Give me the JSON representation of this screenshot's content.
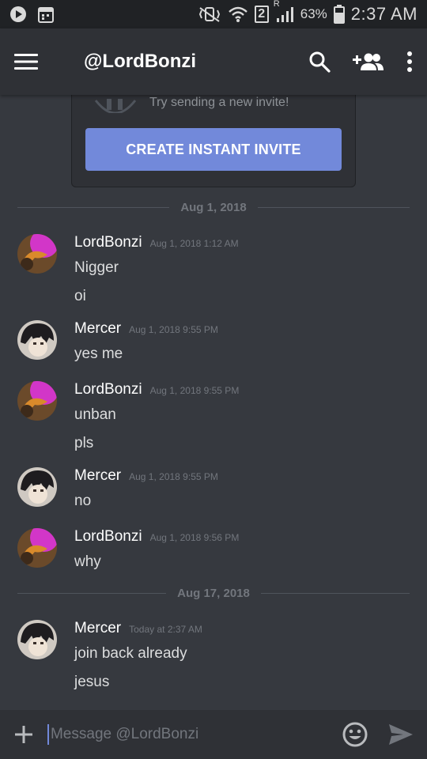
{
  "status_bar": {
    "battery": "63%",
    "time": "2:37 AM",
    "sim_slot": "2",
    "roaming": "R",
    "left_icons": [
      "play-icon",
      "calendar-icon"
    ],
    "right_icons": [
      "mute-vibrate-icon",
      "wifi-icon",
      "sim-icon",
      "signal-icon",
      "battery-icon"
    ]
  },
  "app_bar": {
    "title": "@LordBonzi",
    "icons": [
      "menu-icon",
      "search-icon",
      "add-friend-icon",
      "more-icon"
    ]
  },
  "invite_card": {
    "hint": "Try sending a new invite!",
    "button_label": "CREATE INSTANT INVITE"
  },
  "dividers": [
    "Aug 1, 2018",
    "Aug 17, 2018"
  ],
  "messages": [
    {
      "author": "LordBonzi",
      "timestamp": "Aug 1, 2018 1:12 AM",
      "lines": [
        "Nigger",
        "oi"
      ]
    },
    {
      "author": "Mercer",
      "timestamp": "Aug 1, 2018 9:55 PM",
      "lines": [
        "yes me"
      ]
    },
    {
      "author": "LordBonzi",
      "timestamp": "Aug 1, 2018 9:55 PM",
      "lines": [
        "unban",
        "pls"
      ]
    },
    {
      "author": "Mercer",
      "timestamp": "Aug 1, 2018 9:55 PM",
      "lines": [
        "no"
      ]
    },
    {
      "author": "LordBonzi",
      "timestamp": "Aug 1, 2018 9:56 PM",
      "lines": [
        "why"
      ]
    },
    {
      "author": "Mercer",
      "timestamp": "Today at 2:37 AM",
      "lines": [
        "join back already",
        "jesus"
      ]
    }
  ],
  "composer": {
    "placeholder": "Message @LordBonzi",
    "icons": [
      "plus-icon",
      "emoji-icon",
      "send-icon"
    ]
  },
  "colors": {
    "background": "#36393f",
    "header": "#2f3136",
    "status_bar": "#202225",
    "accent": "#7289da",
    "muted": "#72767d",
    "text": "#dcddde"
  }
}
